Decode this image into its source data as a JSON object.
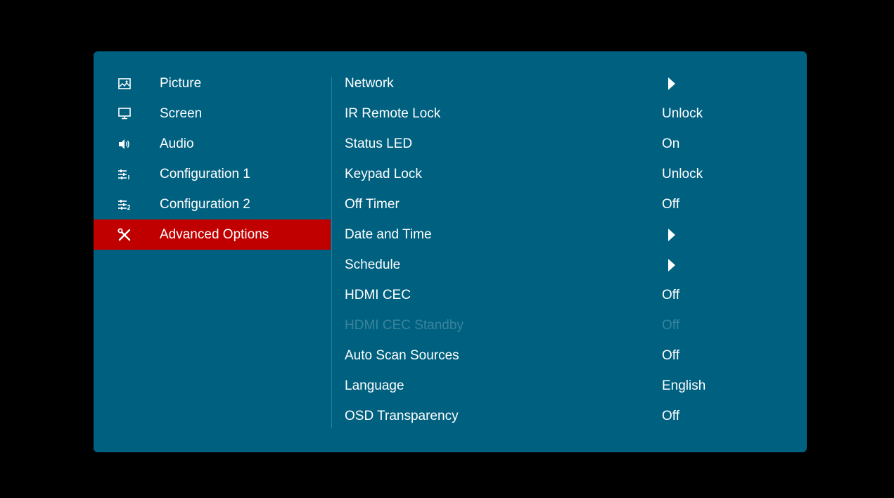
{
  "sidebar": {
    "items": [
      {
        "label": "Picture",
        "icon": "picture-icon",
        "active": false
      },
      {
        "label": "Screen",
        "icon": "monitor-icon",
        "active": false
      },
      {
        "label": "Audio",
        "icon": "speaker-icon",
        "active": false
      },
      {
        "label": "Configuration 1",
        "icon": "sliders-1-icon",
        "active": false
      },
      {
        "label": "Configuration 2",
        "icon": "sliders-2-icon",
        "active": false
      },
      {
        "label": "Advanced Options",
        "icon": "tools-icon",
        "active": true
      }
    ]
  },
  "settings": {
    "items": [
      {
        "label": "Network",
        "value": "",
        "has_submenu": true,
        "disabled": false
      },
      {
        "label": "IR Remote Lock",
        "value": "Unlock",
        "has_submenu": false,
        "disabled": false
      },
      {
        "label": "Status LED",
        "value": "On",
        "has_submenu": false,
        "disabled": false
      },
      {
        "label": "Keypad Lock",
        "value": "Unlock",
        "has_submenu": false,
        "disabled": false
      },
      {
        "label": "Off Timer",
        "value": "Off",
        "has_submenu": false,
        "disabled": false
      },
      {
        "label": "Date and Time",
        "value": "",
        "has_submenu": true,
        "disabled": false
      },
      {
        "label": "Schedule",
        "value": "",
        "has_submenu": true,
        "disabled": false
      },
      {
        "label": "HDMI CEC",
        "value": "Off",
        "has_submenu": false,
        "disabled": false
      },
      {
        "label": "HDMI CEC Standby",
        "value": "Off",
        "has_submenu": false,
        "disabled": true
      },
      {
        "label": "Auto Scan Sources",
        "value": "Off",
        "has_submenu": false,
        "disabled": false
      },
      {
        "label": "Language",
        "value": "English",
        "has_submenu": false,
        "disabled": false
      },
      {
        "label": "OSD Transparency",
        "value": "Off",
        "has_submenu": false,
        "disabled": false
      }
    ]
  },
  "colors": {
    "panel_bg": "#006080",
    "active_bg": "#c00000",
    "text": "#ffffff"
  }
}
